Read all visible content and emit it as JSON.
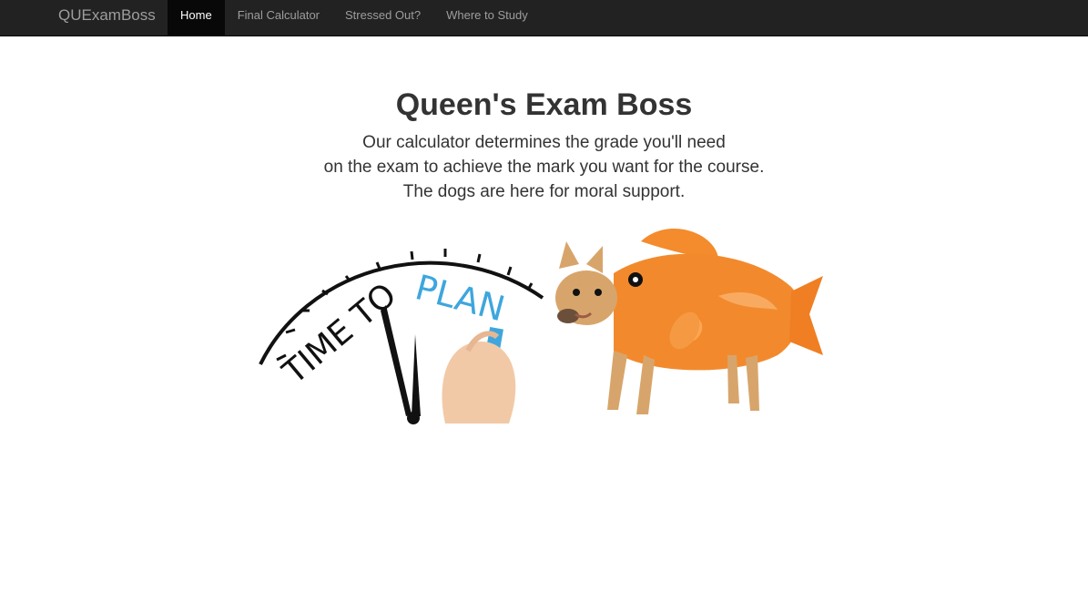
{
  "navbar": {
    "brand": "QUExamBoss",
    "items": [
      {
        "label": "Home",
        "active": true
      },
      {
        "label": "Final Calculator",
        "active": false
      },
      {
        "label": "Stressed Out?",
        "active": false
      },
      {
        "label": "Where to Study",
        "active": false
      }
    ]
  },
  "hero": {
    "title": "Queen's Exam Boss",
    "lines": [
      "Our calculator determines the grade you'll need",
      "on the exam to achieve the mark you want for the course.",
      "The dogs are here for moral support."
    ]
  },
  "images": {
    "clock_text_1": "TIME TO",
    "clock_text_2": "PLAN"
  },
  "colors": {
    "navbar_bg": "#222222",
    "active_bg": "#080808",
    "plan_blue": "#3ea6dd",
    "fish_orange": "#f08a2c"
  }
}
